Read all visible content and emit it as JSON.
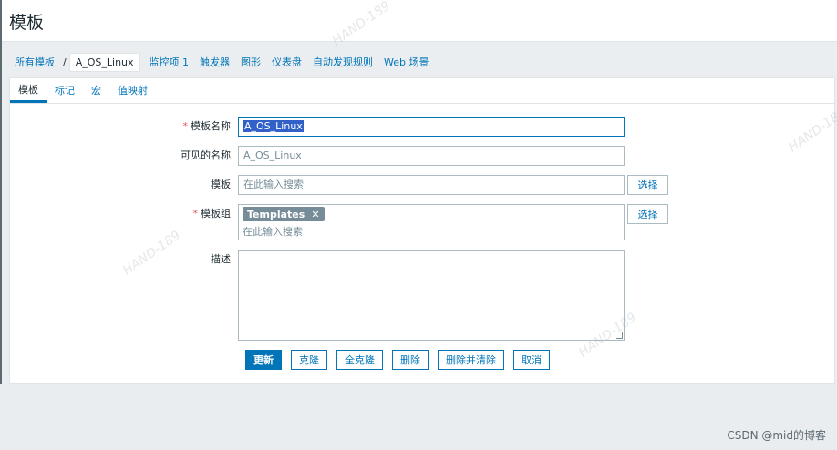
{
  "header": {
    "title": "模板"
  },
  "breadcrumb": {
    "root": "所有模板",
    "separator": "/",
    "current": "A_OS_Linux"
  },
  "nav": [
    {
      "label": "监控项 1"
    },
    {
      "label": "触发器"
    },
    {
      "label": "图形"
    },
    {
      "label": "仪表盘"
    },
    {
      "label": "自动发现规则"
    },
    {
      "label": "Web 场景"
    }
  ],
  "tabs": [
    {
      "label": "模板",
      "active": true
    },
    {
      "label": "标记"
    },
    {
      "label": "宏"
    },
    {
      "label": "值映射"
    }
  ],
  "form": {
    "required_mark": "*",
    "template_name": {
      "label": "模板名称",
      "value": "A_OS_Linux"
    },
    "visible_name": {
      "label": "可见的名称",
      "placeholder": "A_OS_Linux"
    },
    "templates": {
      "label": "模板",
      "placeholder": "在此输入搜索",
      "button": "选择"
    },
    "groups": {
      "label": "模板组",
      "chips": [
        "Templates"
      ],
      "placeholder": "在此输入搜索",
      "button": "选择"
    },
    "description": {
      "label": "描述",
      "value": ""
    }
  },
  "buttons": {
    "update": "更新",
    "clone": "克隆",
    "full_clone": "全克隆",
    "delete": "删除",
    "delete_clear": "删除并清除",
    "cancel": "取消"
  },
  "footer": {
    "watermark": "CSDN @mid的博客"
  },
  "watermarks": [
    "HAND-189",
    "HAND-189",
    "HAND-189",
    "HAND-189"
  ],
  "colors": {
    "accent": "#0275b8",
    "chip": "#768d99",
    "required": "#e45959"
  }
}
